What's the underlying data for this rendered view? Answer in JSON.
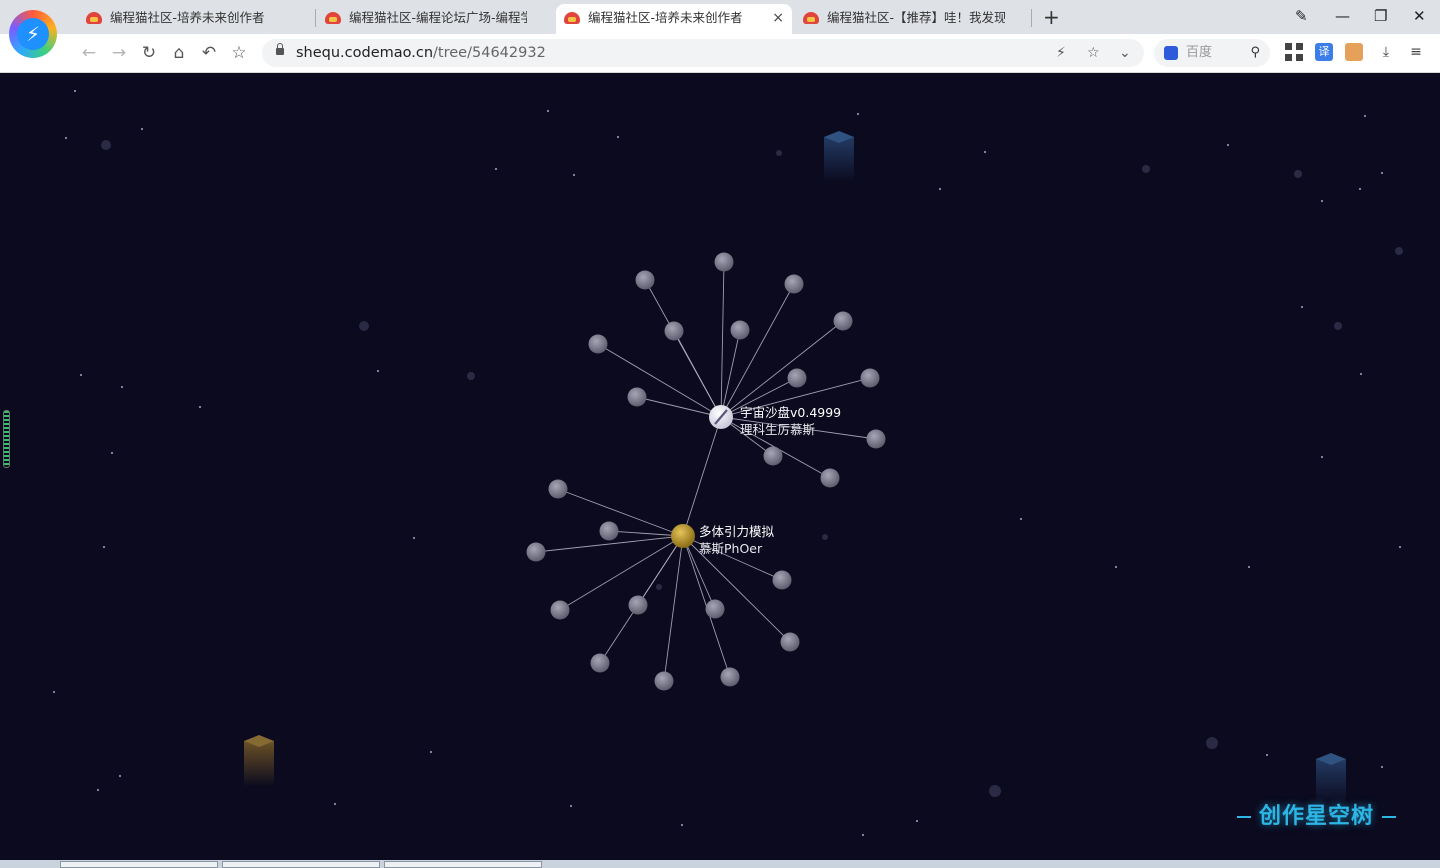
{
  "browser": {
    "tabs": [
      {
        "title": "编程猫社区-培养未来创作者",
        "active": false
      },
      {
        "title": "编程猫社区-编程论坛广场-编程学习",
        "active": false
      },
      {
        "title": "编程猫社区-培养未来创作者",
        "active": true
      },
      {
        "title": "编程猫社区-【推荐】哇！我发现了宝",
        "active": false
      }
    ],
    "close_glyph": "×",
    "new_tab_glyph": "+",
    "url_host": "shequ.codemao.cn",
    "url_path": "/tree/54642932",
    "search_engine": "百度",
    "icons": {
      "back": "←",
      "forward": "→",
      "reload": "↻",
      "home": "⌂",
      "undo": "↶",
      "bookmark": "☆",
      "bolt": "⚡",
      "star": "☆",
      "chevron": "⌄",
      "search": "⚲",
      "download": "⤓",
      "menu": "≡",
      "minimize": "—",
      "restore": "❐",
      "close": "✕",
      "note": "✎",
      "translate": "译"
    }
  },
  "tree": {
    "root": {
      "title": "宇宙沙盘v0.4999",
      "author": "理科生厉慕斯"
    },
    "child": {
      "title": "多体引力模拟",
      "author": "慕斯PhOer"
    },
    "root_branch_count": 14,
    "child_branch_count": 12
  },
  "brand_title": "创作星空树",
  "colors": {
    "background": "#0b0a1e",
    "node": "#5e5d6e",
    "child_node": "#c9a22a",
    "brand": "#2cb6e6"
  }
}
